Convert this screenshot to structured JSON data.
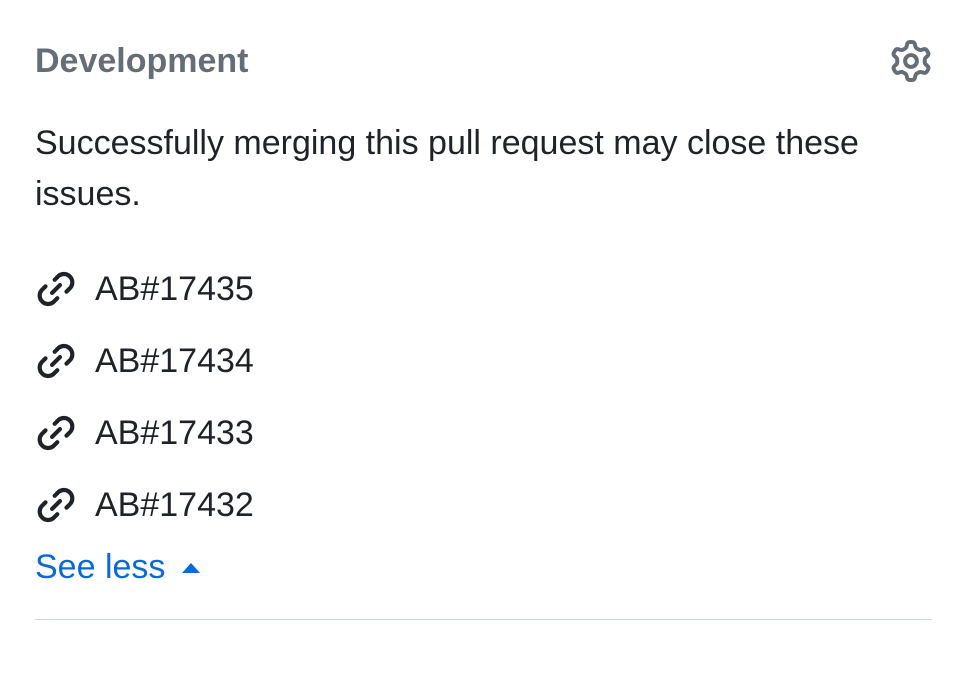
{
  "section": {
    "title": "Development",
    "description": "Successfully merging this pull request may close these issues."
  },
  "linked_issues": [
    {
      "label": "AB#17435"
    },
    {
      "label": "AB#17434"
    },
    {
      "label": "AB#17433"
    },
    {
      "label": "AB#17432"
    }
  ],
  "toggle": {
    "label": "See less"
  }
}
